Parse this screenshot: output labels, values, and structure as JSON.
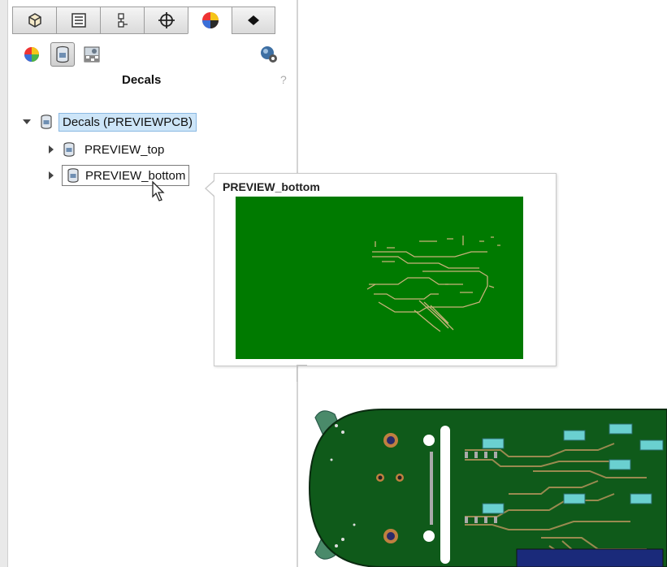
{
  "pane": {
    "title": "Decals",
    "help_symbol": "?",
    "tabs": [
      {
        "icon": "feature-manager-icon"
      },
      {
        "icon": "property-manager-icon"
      },
      {
        "icon": "configuration-manager-icon"
      },
      {
        "icon": "dimxpert-icon"
      },
      {
        "icon": "display-manager-icon",
        "active": true
      },
      {
        "icon": "cam-icon"
      }
    ],
    "toolbar": [
      {
        "icon": "appearances-icon"
      },
      {
        "icon": "decals-icon",
        "pressed": true
      },
      {
        "icon": "scenes-icon"
      },
      {
        "icon": "settings-icon"
      }
    ]
  },
  "tree": {
    "root": {
      "label": "Decals (PREVIEWPCB)"
    },
    "children": [
      {
        "label": "PREVIEW_top"
      },
      {
        "label": "PREVIEW_bottom"
      }
    ]
  },
  "tooltip": {
    "title": "PREVIEW_bottom",
    "preview_color": "#007a00",
    "trace_color": "#c9b27a"
  },
  "board": {
    "pcb_color": "#0f5a1a",
    "pad_color": "#6ad0d0",
    "mount_color": "#4a8a6a"
  }
}
